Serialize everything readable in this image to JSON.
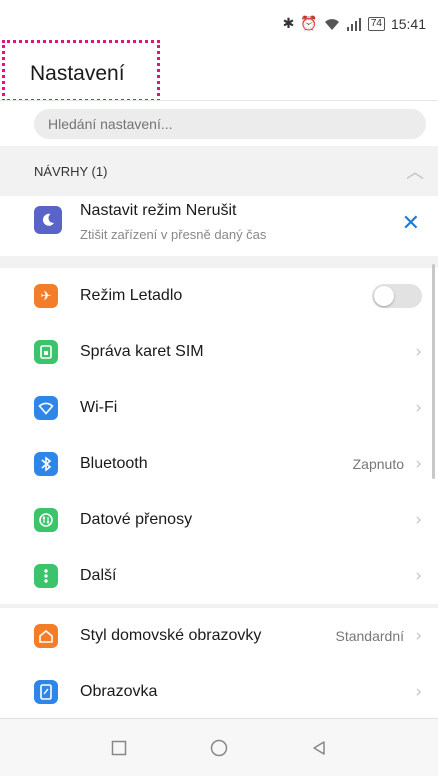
{
  "status_bar": {
    "battery": "74",
    "time": "15:41"
  },
  "header": {
    "title": "Nastavení"
  },
  "search": {
    "placeholder": "Hledání nastavení..."
  },
  "suggestions": {
    "title": "NÁVRHY (1)",
    "items": [
      {
        "title": "Nastavit režim Nerušit",
        "subtitle": "Ztišit zařízení v přesně daný čas",
        "icon": "moon-icon",
        "color": "#5a64c8"
      }
    ]
  },
  "section1": {
    "items": [
      {
        "label": "Režim Letadlo",
        "icon": "airplane-icon",
        "color": "#f47d2a",
        "toggle": false
      },
      {
        "label": "Správa karet SIM",
        "icon": "sim-card-icon",
        "color": "#3cc46c"
      },
      {
        "label": "Wi-Fi",
        "icon": "wifi-icon",
        "color": "#2e86e8"
      },
      {
        "label": "Bluetooth",
        "icon": "bluetooth-icon",
        "color": "#2e86e8",
        "value": "Zapnuto"
      },
      {
        "label": "Datové přenosy",
        "icon": "data-transfer-icon",
        "color": "#3cc46c"
      },
      {
        "label": "Další",
        "icon": "more-icon",
        "color": "#3cc46c"
      }
    ]
  },
  "section2": {
    "items": [
      {
        "label": "Styl domovské obrazovky",
        "icon": "home-style-icon",
        "color": "#f47d2a",
        "value": "Standardní"
      },
      {
        "label": "Obrazovka",
        "icon": "display-icon",
        "color": "#2e86e8"
      }
    ]
  }
}
